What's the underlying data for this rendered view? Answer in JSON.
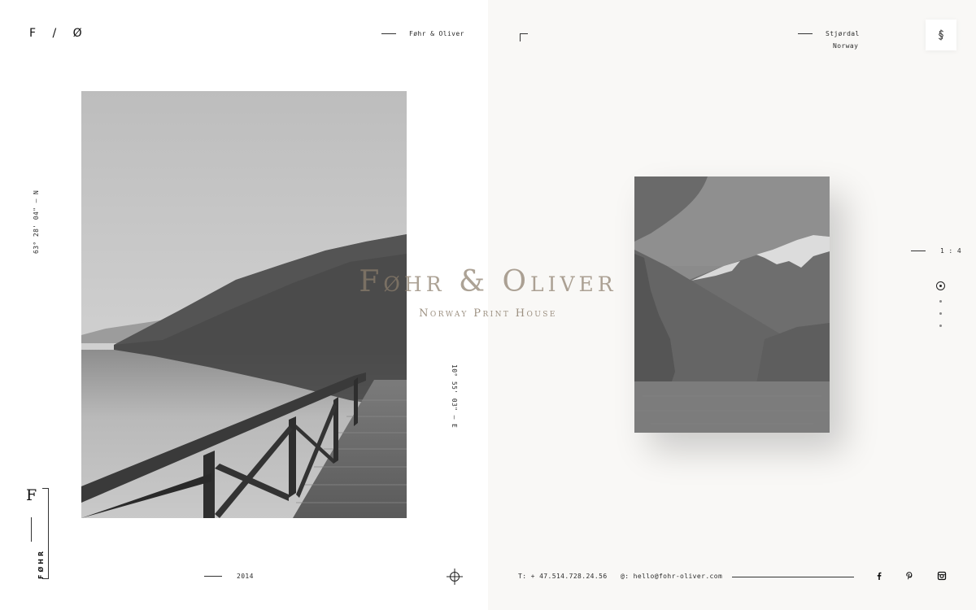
{
  "header": {
    "logo": "F / Ø",
    "brand": "Føhr & Oliver",
    "location_city": "Stjørdal",
    "location_country": "Norway"
  },
  "hero": {
    "title": "Føhr & Oliver",
    "subtitle": "Norway Print House"
  },
  "coordinates": {
    "latitude": "63° 28' 04\" — N",
    "longitude": "10° 55' 03\" — E"
  },
  "slider": {
    "counter": "1 : 4",
    "total_dots": 3
  },
  "side_brand": {
    "mark": "F",
    "word": "FØHR"
  },
  "footer": {
    "year": "2014",
    "phone": "T: + 47.514.728.24.56",
    "email": "@: hello@fohr-oliver.com"
  },
  "social": [
    "facebook-icon",
    "pinterest-icon",
    "instagram-icon"
  ]
}
